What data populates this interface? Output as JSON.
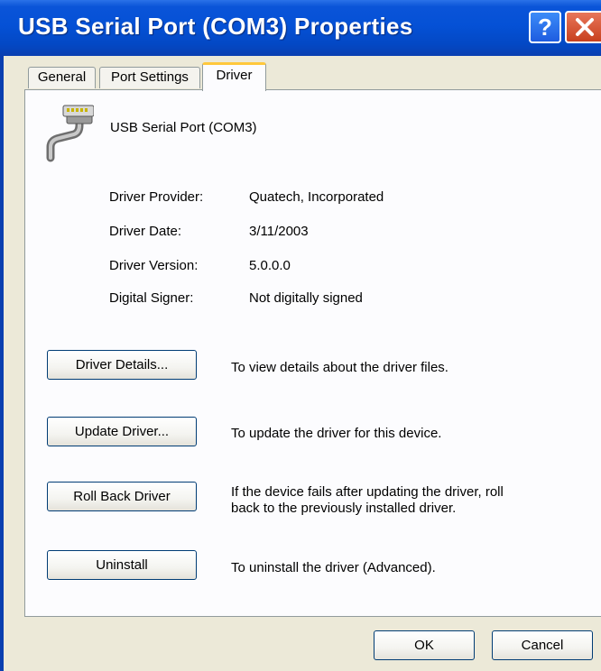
{
  "window": {
    "title": "USB Serial Port (COM3) Properties",
    "help_glyph": "?",
    "close_icon": "close-icon"
  },
  "tabs": [
    {
      "label": "General"
    },
    {
      "label": "Port Settings"
    },
    {
      "label": "Driver",
      "active": true
    }
  ],
  "device": {
    "icon": "serial-port-icon",
    "name": "USB Serial Port (COM3)"
  },
  "driver_info": {
    "provider_label": "Driver Provider:",
    "provider_value": "Quatech, Incorporated",
    "date_label": "Driver Date:",
    "date_value": "3/11/2003",
    "version_label": "Driver Version:",
    "version_value": "5.0.0.0",
    "signer_label": "Digital Signer:",
    "signer_value": "Not digitally signed"
  },
  "actions": {
    "details_label": "Driver Details...",
    "details_desc": "To view details about the driver files.",
    "update_label": "Update Driver...",
    "update_desc": "To update the driver for this device.",
    "rollback_label": "Roll Back Driver",
    "rollback_desc_1": "If the device fails after updating the driver, roll",
    "rollback_desc_2": "back to the previously installed driver.",
    "uninstall_label": "Uninstall",
    "uninstall_desc": "To uninstall the driver (Advanced)."
  },
  "footer": {
    "ok_label": "OK",
    "cancel_label": "Cancel"
  }
}
